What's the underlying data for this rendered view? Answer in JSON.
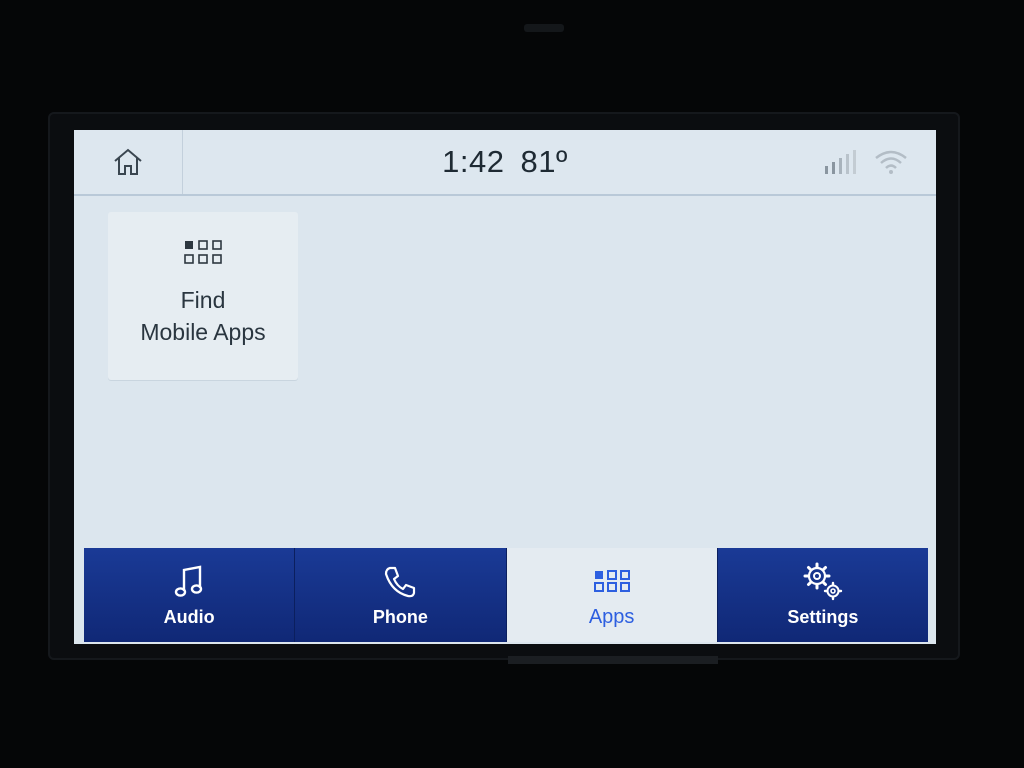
{
  "status_bar": {
    "time": "1:42",
    "temperature": "81º"
  },
  "apps": [
    {
      "label_line1": "Find",
      "label_line2": "Mobile Apps",
      "icon": "grid-icon"
    }
  ],
  "nav": {
    "items": [
      {
        "label": "Audio",
        "icon": "music-note-icon"
      },
      {
        "label": "Phone",
        "icon": "phone-icon"
      },
      {
        "label": "Apps",
        "icon": "grid-icon",
        "active": true
      },
      {
        "label": "Settings",
        "icon": "gears-icon"
      }
    ]
  },
  "colors": {
    "nav_background": "#14308a",
    "active_accent": "#2d5fe0",
    "screen_background": "#dce6ee"
  }
}
